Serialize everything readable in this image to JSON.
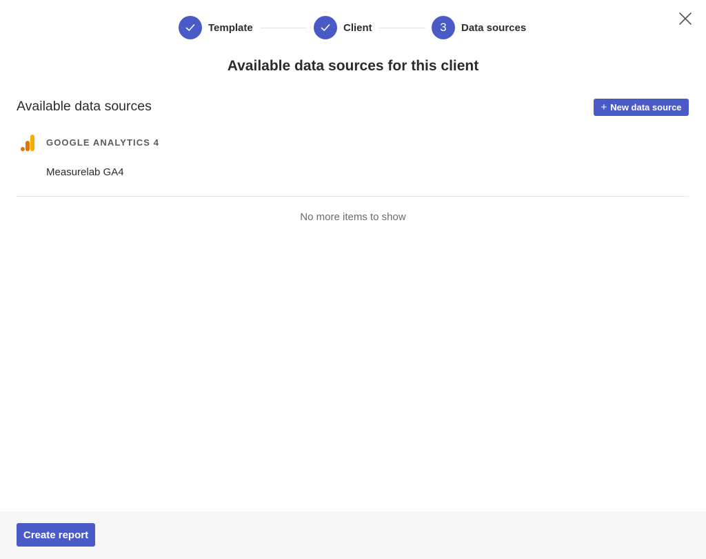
{
  "stepper": {
    "steps": [
      {
        "label": "Template",
        "state": "done",
        "icon": "check-icon"
      },
      {
        "label": "Client",
        "state": "done",
        "icon": "check-icon"
      },
      {
        "label": "Data sources",
        "state": "current",
        "number": "3"
      }
    ]
  },
  "modal": {
    "close_icon": "close-icon",
    "title": "Available data sources for this client"
  },
  "sources": {
    "heading": "Available data sources",
    "new_button_label": "New data source",
    "new_button_icon": "plus-icon",
    "groups": [
      {
        "provider": "GOOGLE ANALYTICS 4",
        "icon": "google-analytics-icon",
        "items": [
          {
            "name": "Measurelab GA4"
          }
        ]
      }
    ],
    "empty_note": "No more items to show"
  },
  "footer": {
    "create_label": "Create report"
  },
  "colors": {
    "accent": "#4a5bc8",
    "ga_orange": "#f9ab00",
    "ga_dark_orange": "#e37400",
    "footer_bg": "#f7f7f7"
  }
}
